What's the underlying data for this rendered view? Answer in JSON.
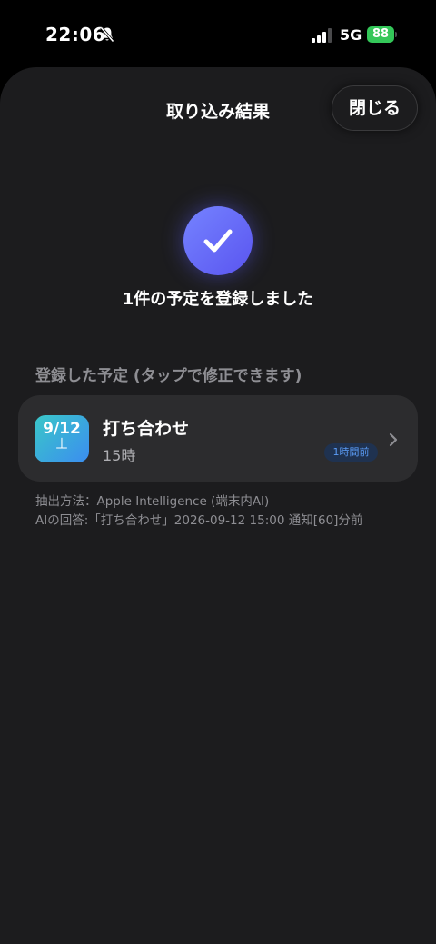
{
  "status_bar": {
    "time": "22:06",
    "network": "5G",
    "battery": "88",
    "icons": [
      "bell-slash-icon",
      "signal-icon",
      "battery-charging-icon"
    ]
  },
  "header": {
    "title": "取り込み結果",
    "close_label": "閉じる"
  },
  "result": {
    "icon": "checkmark-icon",
    "message": "1件の予定を登録しました"
  },
  "section": {
    "heading": "登録した予定 (タップで修正できます)"
  },
  "event": {
    "date": "9/12",
    "weekday": "土",
    "title": "打ち合わせ",
    "time": "15時",
    "reminder": "1時間前",
    "icon": "chevron-right-icon"
  },
  "footnote": {
    "method": "抽出方法：Apple Intelligence (端末内AI)",
    "ai_answer": "AIの回答:「打ち合わせ」2026-09-12 15:00 通知[60]分前"
  },
  "colors": {
    "background": "#000000",
    "sheet": "#1c1c1e",
    "card": "#2c2c2e",
    "accent": "#6a6cff",
    "battery": "#34c759",
    "secondary_text": "#8e8e93"
  }
}
